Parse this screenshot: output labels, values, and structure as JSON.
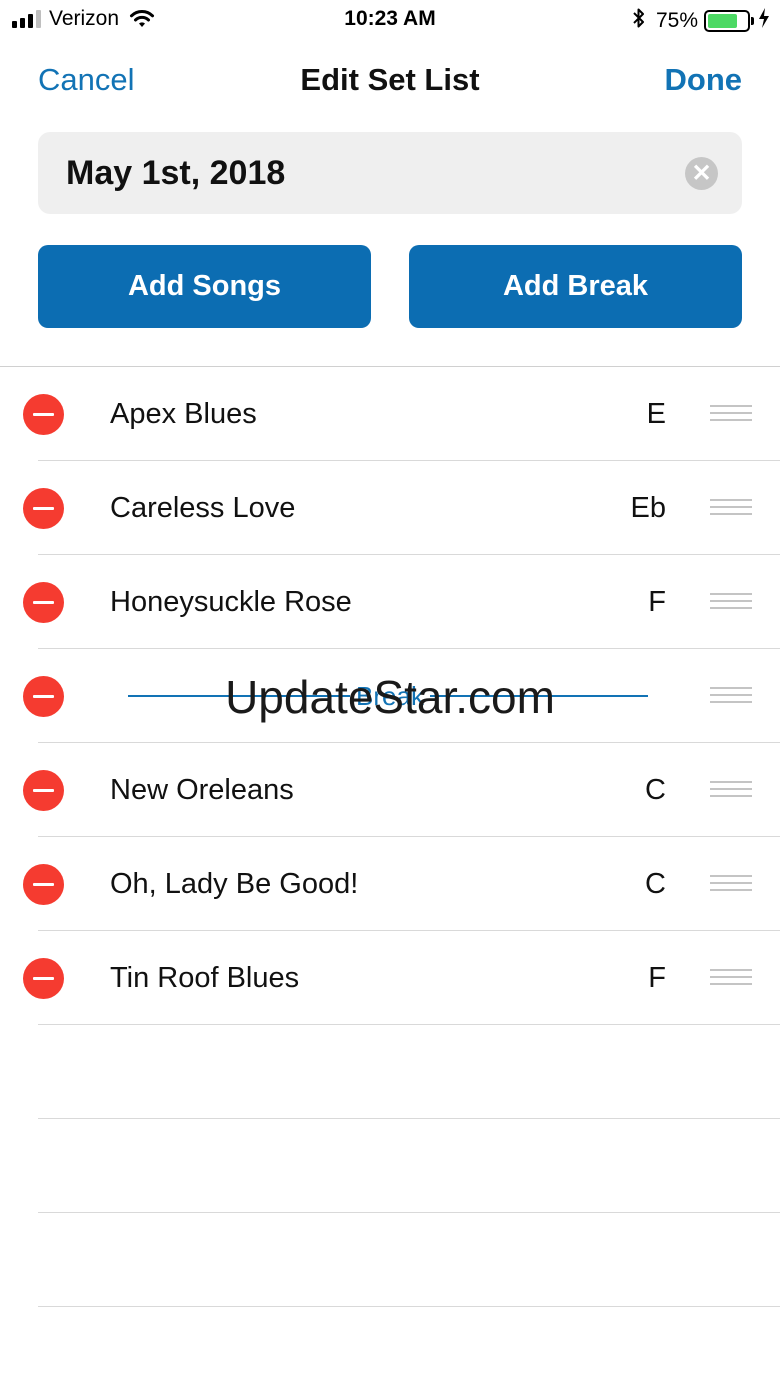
{
  "status_bar": {
    "carrier": "Verizon",
    "time": "10:23 AM",
    "battery_percent": "75%",
    "battery_level": 0.75,
    "signal_icon": "cellular-signal-icon",
    "wifi_icon": "wifi-icon",
    "bluetooth_icon": "bluetooth-icon",
    "charging_icon": "charging-bolt-icon"
  },
  "nav": {
    "cancel_label": "Cancel",
    "title": "Edit Set List",
    "done_label": "Done"
  },
  "set_name": {
    "value": "May 1st, 2018",
    "clear_icon": "clear-icon",
    "clear_glyph": "✕"
  },
  "actions": {
    "add_songs_label": "Add Songs",
    "add_break_label": "Add Break"
  },
  "list": {
    "items": [
      {
        "title": "Apex Blues",
        "key": "E"
      },
      {
        "title": "Careless Love",
        "key": "Eb"
      },
      {
        "title": "Honeysuckle Rose",
        "key": "F"
      },
      {
        "type": "break",
        "label": "Break"
      },
      {
        "title": "New Oreleans",
        "key": "C"
      },
      {
        "title": "Oh, Lady Be Good!",
        "key": "C"
      },
      {
        "title": "Tin Roof Blues",
        "key": "F"
      }
    ]
  },
  "watermark": "UpdateStar.com",
  "colors": {
    "accent": "#1273b5",
    "button": "#0c6db2",
    "delete": "#f53b30",
    "battery": "#4cd964"
  }
}
